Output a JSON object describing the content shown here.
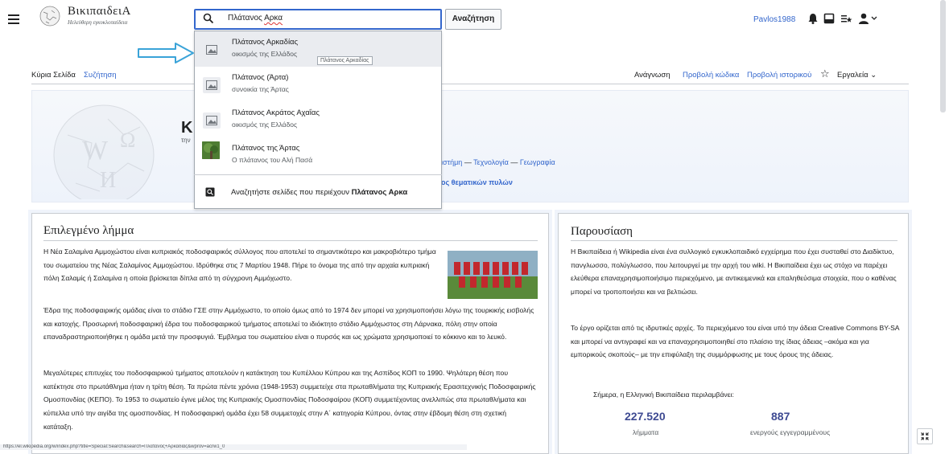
{
  "header": {
    "wordmark": "ΒικιπαιδειΑ",
    "tagline": "Ηελεύθερη εγκυκλοπαίδεια",
    "search": {
      "value_plain": "Πλάτανος ",
      "value_squiggle": "Αρκα",
      "button": "Αναζήτηση"
    },
    "user": "Pavlos1988"
  },
  "tabs": {
    "main": "Κύρια Σελίδα",
    "talk": "Συζήτηση",
    "read": "Ανάγνωση",
    "edit": "Προβολή κώδικα",
    "history": "Προβολή ιστορικού",
    "tools": "Εργαλεία"
  },
  "dropdown": {
    "suggestions": [
      {
        "title": "Πλάτανος Αρκαδίας",
        "desc": "οικισμός της Ελλάδος",
        "thumb": "image-placeholder"
      },
      {
        "title": "Πλάτανος (Άρτα)",
        "desc": "συνοικία της Άρτας",
        "thumb": "image-placeholder"
      },
      {
        "title": "Πλάτανος Ακράτος Αχαΐας",
        "desc": "οικισμός της Ελλάδος",
        "thumb": "image-placeholder"
      },
      {
        "title": "Πλάτανος της Άρτας",
        "desc": "Ο πλάτανος του Αλή Πασά",
        "thumb": "photo"
      }
    ],
    "tooltip": "Πλάτανος Αρκαδίας",
    "search_containing_prefix": "Αναζητήστε σελίδες που περιέχουν ",
    "search_containing_term": "Πλάτανος Αρκα"
  },
  "banner": {
    "title": "Κ",
    "small": "την",
    "portals": [
      "ιστήμη",
      "Τεχνολογία",
      "Γεωγραφία"
    ],
    "topics": "ος θεματικών πυλών"
  },
  "featured": {
    "title": "Επιλεγμένο λήμμα",
    "p1": "Η Νέα Σαλαμίνα Αμμοχώστου είναι κυπριακός ποδοσφαιρικός σύλλογος που αποτελεί το σημαντικότερο και μακροβιότερο τμήμα του σωματείου της Νέας Σαλαμίνος Αμμοχώστου. Ιδρύθηκε στις 7 Μαρτίου 1948. Πήρε το όνομα της από την αρχαία κυπριακή πόλη Σαλαμίς ή Σαλαμίνα η οποία βρίσκεται δίπλα από τη σύγχρονη Αμμόχωστο.",
    "p2": "Έδρα της ποδοσφαιρικής ομάδας είναι το στάδιο ΓΣΕ στην Αμμόχωστο, το οποίο όμως από το 1974 δεν μπορεί να χρησιμοποιήσει λόγω της τουρκικής εισβολής και κατοχής. Προσωρινή ποδοσφαιρική έδρα του ποδοσφαιρικού τμήματος αποτελεί το ιδιόκτητο στάδιο Αμμόχωστος στη Λάρνακα, πόλη στην οποία επαναδραστηριοποιήθηκε η ομάδα μετά την προσφυγιά. Έμβλημα του σωματείου είναι ο πυρσός και ως χρώματα χρησιμοποιεί το κόκκινο και το λευκό.",
    "p3": "Μεγαλύτερες επιτυχίες του ποδοσφαιρικού τμήματος αποτελούν η κατάκτηση του Κυπέλλου Κύπρου και της Ασπίδος ΚΟΠ το 1990. Ψηλότερη θέση που κατέκτησε στο πρωτάθλημα ήταν η τρίτη θέση. Τα πρώτα πέντε χρόνια (1948-1953) συμμετείχε στα πρωταθλήματα της Κυπριακής Ερασιτεχνικής Ποδοσφαιρικής Ομοσπονδίας (ΚΕΠΟ). Το 1953 το σωματείο έγινε μέλος της Κυπριακής Ομοσπονδίας Ποδοσφαίρου (ΚΟΠ) συμμετέχοντας ανελλιπώς στα πρωταθλήματα και κύπελλα υπό την αιγίδα της ομοσπονδίας. Η ποδοσφαιρική ομάδα έχει 58 συμμετοχές στην Α΄ κατηγορία Κύπρου, όντας στην έβδομη θέση στη σχετική κατάταξη."
  },
  "intro": {
    "title": "Παρουσίαση",
    "p1": "Η Βικιπαίδεια ή Wikipedia είναι ένα συλλογικό εγκυκλοπαιδικό εγχείρημα που έχει συσταθεί στο Διαδίκτυο, πανγλωσσο, πολύγλωσσο, που λειτουργεί με την αρχή του wiki. Η Βικιπαίδεια έχει ως στόχο να παρέχει ελεύθερα επαναχρησιμοποιήσιμο περιεχόμενο, με αντικειμενικά και επαληθεύσιμα στοιχεία, που ο καθένας μπορεί να τροποποιήσει και να βελτιώσει.",
    "p2": "Το έργο ορίζεται από τις ιδρυτικές αρχές. Το περιεχόμενο του είναι υπό την άδεια Creative Commons BY-SA και μπορεί να αντιγραφεί και να επαναχρησιμοποιηθεί στο πλαίσιο της ίδιας άδειας –ακόμα και για εμπορικούς σκοπούς– με την επιφύλαξη της συμμόρφωσης με τους όρους της άδειας.",
    "stats_lead": "Σήμερα, η Ελληνική Βικιπαίδεια περιλαμβάνει:",
    "stats": [
      {
        "value": "227.520",
        "label": "λήμματα"
      },
      {
        "value": "887",
        "label": "ενεργούς εγγεγραμμένους"
      }
    ]
  },
  "statusbar": "https://el.wikipedia.org/w/index.php?title=Special:Search&search=Πλάτανος+Αρκαδίας&wprov=acrw1_0",
  "colors": {
    "link": "#3366cc",
    "stat": "#3e4a92",
    "arrow": "#3aa3d8"
  }
}
